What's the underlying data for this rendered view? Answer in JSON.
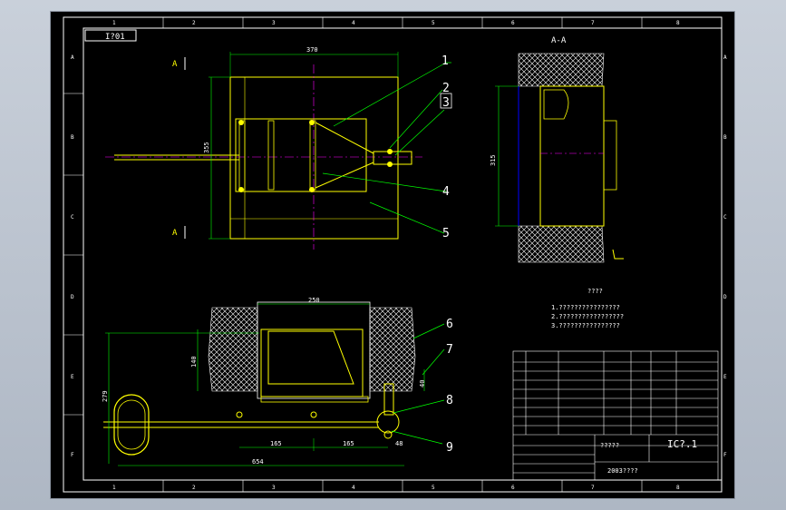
{
  "titles": {
    "stamp": "I?01",
    "section_A": "A",
    "section_view": "A-A",
    "notes_title": "????"
  },
  "dimensions": {
    "width_370": "370",
    "height_355": "355",
    "height_315": "315",
    "width_250": "250",
    "height_140": "140",
    "height_279": "279",
    "dim_40": "40",
    "dim_165a": "165",
    "dim_165b": "165",
    "dim_48": "48",
    "total_654": "654"
  },
  "balloons": [
    "1",
    "2",
    "3",
    "4",
    "5",
    "6",
    "7",
    "8",
    "9"
  ],
  "notes": [
    "1.????????????????",
    "2.?????????????????",
    "3.????????????????"
  ],
  "border_numbers": {
    "top": [
      "1",
      "2",
      "3",
      "4",
      "5",
      "6",
      "7",
      "8"
    ],
    "side": [
      "A",
      "B",
      "C",
      "D",
      "E",
      "F"
    ]
  },
  "title_block": {
    "drawing_no": "IC?.1",
    "company": "2003????",
    "material": "?????"
  },
  "colors": {
    "background": "#000000",
    "outline": "#ffffff",
    "geometry": "#ffff00",
    "dimension": "#00ff00",
    "centerline": "#ff00ff",
    "leader": "#00ff00",
    "hatch": "#ffffff",
    "cut_line": "#0000ff"
  }
}
